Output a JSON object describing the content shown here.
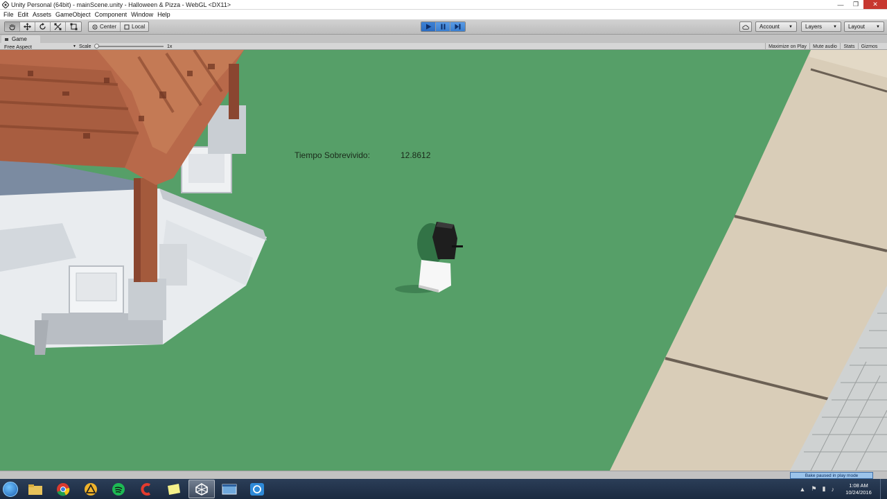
{
  "window": {
    "title": "Unity Personal (64bit) - mainScene.unity - Halloween & Pizza - WebGL <DX11>",
    "minimize": "—",
    "maximize": "❐",
    "close": "✕"
  },
  "menu": [
    "File",
    "Edit",
    "Assets",
    "GameObject",
    "Component",
    "Window",
    "Help"
  ],
  "toolbar": {
    "pivot_label": "Center",
    "space_label": "Local",
    "account_label": "Account",
    "layers_label": "Layers",
    "layout_label": "Layout"
  },
  "game_view": {
    "tab_label": "Game",
    "aspect_label": "Free Aspect",
    "scale_label": "Scale",
    "scale_value": "1x",
    "maximize_on_play": "Maximize on Play",
    "mute_audio": "Mute audio",
    "stats": "Stats",
    "gizmos": "Gizmos"
  },
  "hud": {
    "label": "Tiempo Sobrevivido:",
    "value": "12.8612"
  },
  "status": {
    "bake_message": "Bake paused in play mode"
  },
  "taskbar": {
    "apps": [
      "file-explorer",
      "chrome",
      "app-a",
      "spotify",
      "ccleaner",
      "sticky-notes",
      "unity",
      "window-app",
      "screenshot-app"
    ],
    "active_app": "unity",
    "time": "1:08 AM",
    "date": "10/24/2016"
  },
  "colors": {
    "ground": "#569f68",
    "play_active": "#2c6cc1",
    "roof": "#b8694a",
    "stone": "#d8dde3"
  }
}
